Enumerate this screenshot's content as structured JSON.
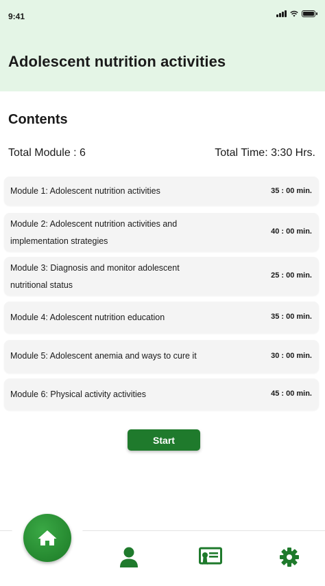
{
  "status_bar": {
    "time": "9:41"
  },
  "header": {
    "title": "Adolescent nutrition activities"
  },
  "contents": {
    "title": "Contents",
    "total_module": "Total Module : 6",
    "total_time": "Total Time: 3:30 Hrs."
  },
  "modules": [
    {
      "lines": [
        "Module 1: Adolescent nutrition activities"
      ],
      "duration": "35 : 00 min."
    },
    {
      "lines": [
        "Module 2: Adolescent nutrition activities and",
        "implementation strategies"
      ],
      "duration": "40 : 00 min."
    },
    {
      "lines": [
        "Module 3: Diagnosis and monitor adolescent",
        "nutritional status"
      ],
      "duration": "25 : 00 min."
    },
    {
      "lines": [
        "Module 4: Adolescent nutrition education"
      ],
      "duration": "35 : 00 min."
    },
    {
      "lines": [
        "Module 5: Adolescent anemia and ways to cure it"
      ],
      "duration": "30 : 00 min."
    },
    {
      "lines": [
        "Module 6: Physical activity activities"
      ],
      "duration": "45 : 00 min."
    }
  ],
  "actions": {
    "start_label": "Start"
  },
  "bottom_nav": {
    "items": [
      {
        "icon": "home-icon"
      },
      {
        "icon": "person-icon"
      },
      {
        "icon": "certificate-icon"
      },
      {
        "icon": "gear-icon"
      }
    ]
  },
  "colors": {
    "accent": "#1f7a2c",
    "header_bg": "#e4f5e6",
    "card_bg": "#f4f4f4"
  }
}
